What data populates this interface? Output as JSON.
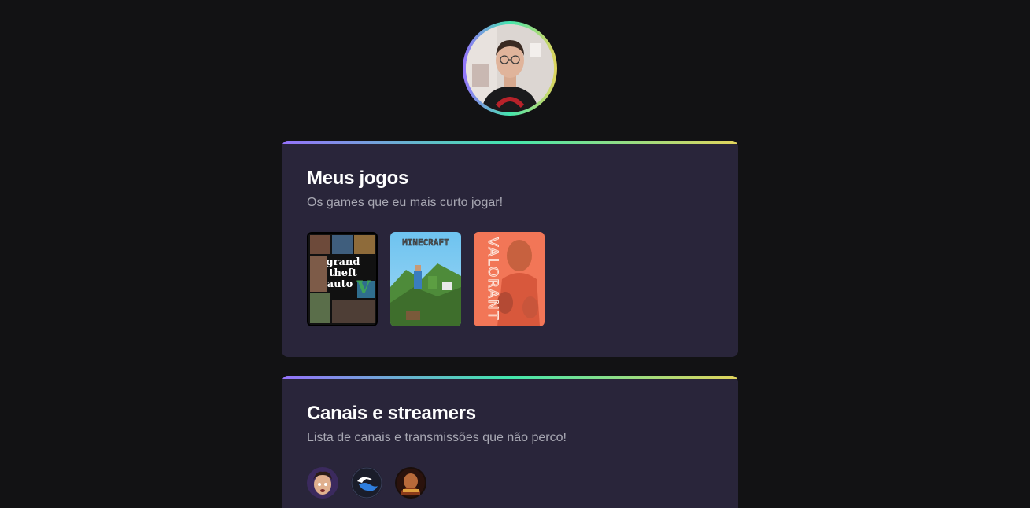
{
  "profile": {
    "avatar_alt": "profile-photo"
  },
  "games_section": {
    "title": "Meus jogos",
    "subtitle": "Os games que eu mais curto jogar!",
    "games": [
      {
        "name": "gta-v-cover",
        "label_lines": [
          "grand",
          "theft",
          "auto"
        ],
        "numeral": "V"
      },
      {
        "name": "minecraft-cover",
        "label": "MINECRAFT"
      },
      {
        "name": "valorant-cover",
        "label": "VALORANT"
      }
    ]
  },
  "channels_section": {
    "title": "Canais e streamers",
    "subtitle": "Lista de canais e transmissões que não perco!",
    "channels": [
      {
        "name": "channel-avatar-1"
      },
      {
        "name": "channel-avatar-2"
      },
      {
        "name": "channel-avatar-3"
      }
    ]
  },
  "colors": {
    "background": "#121214",
    "card": "#29253a",
    "gradient_start": "#9572fc",
    "gradient_mid": "#43e7ad",
    "gradient_end": "#e2d45c",
    "title": "#ffffff",
    "subtitle": "#a8a8b3"
  }
}
